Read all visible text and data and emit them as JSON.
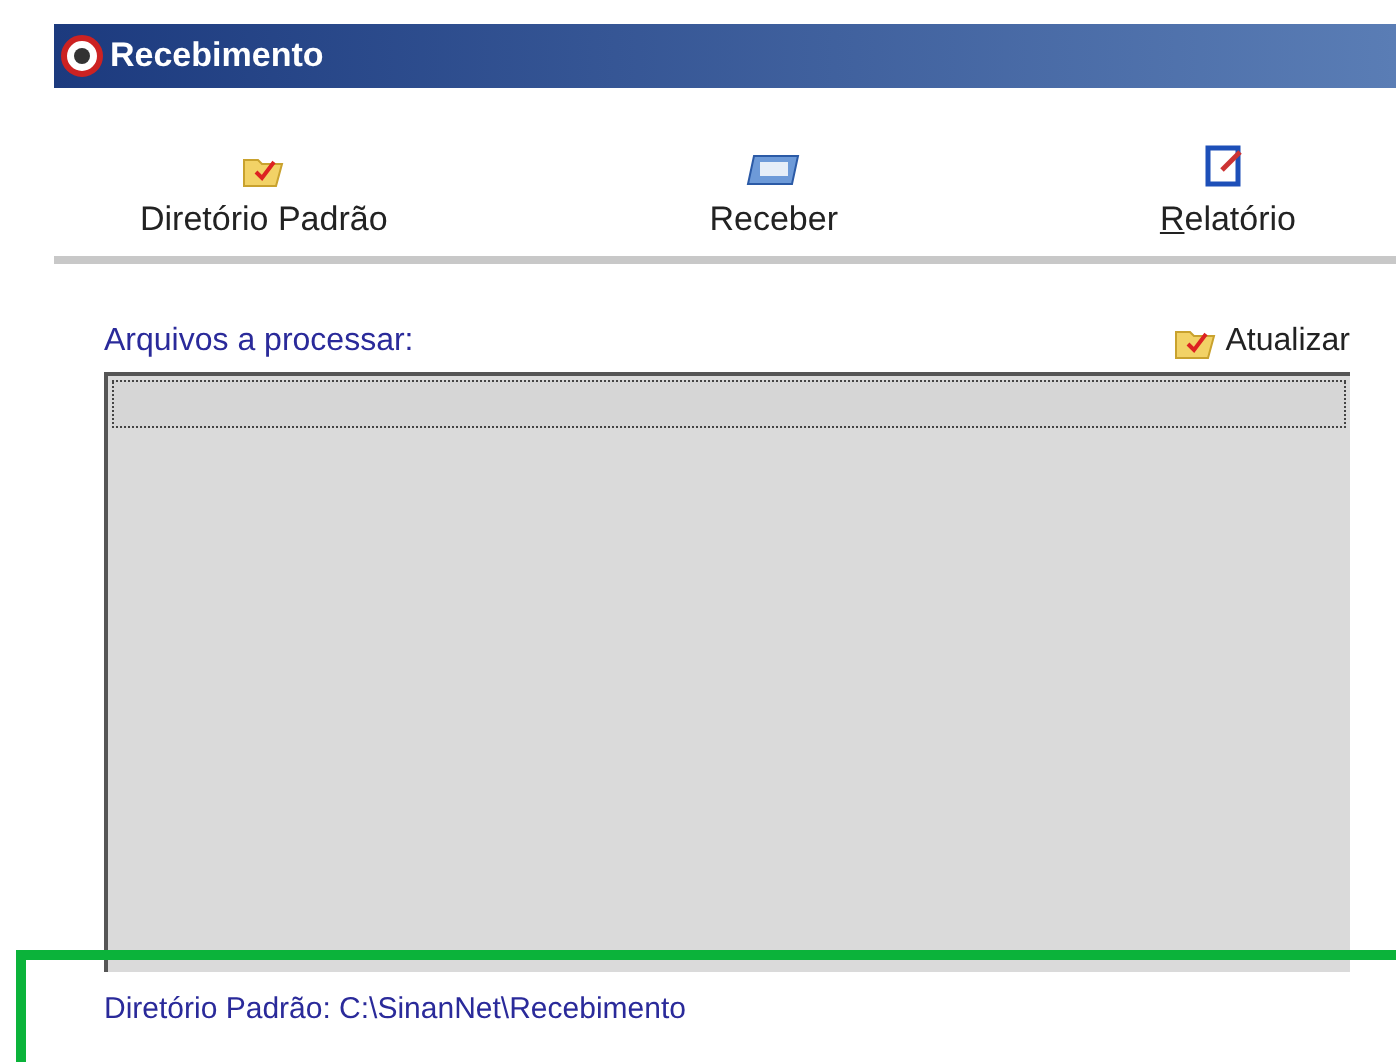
{
  "window": {
    "title": "Recebimento"
  },
  "toolbar": [
    {
      "label": "Diretório Padrão",
      "kind": "folder",
      "mnemonic": false
    },
    {
      "label": "Receber",
      "kind": "tray",
      "mnemonic": false
    },
    {
      "label": "Relatório",
      "kind": "report",
      "mnemonic": true
    }
  ],
  "files": {
    "label": "Arquivos a processar:",
    "refresh": "Atualizar",
    "rows": [
      {
        "selected": true
      }
    ]
  },
  "status": {
    "text": "Diretório Padrão: C:\\SinanNet\\Recebimento",
    "highlighted": true
  }
}
